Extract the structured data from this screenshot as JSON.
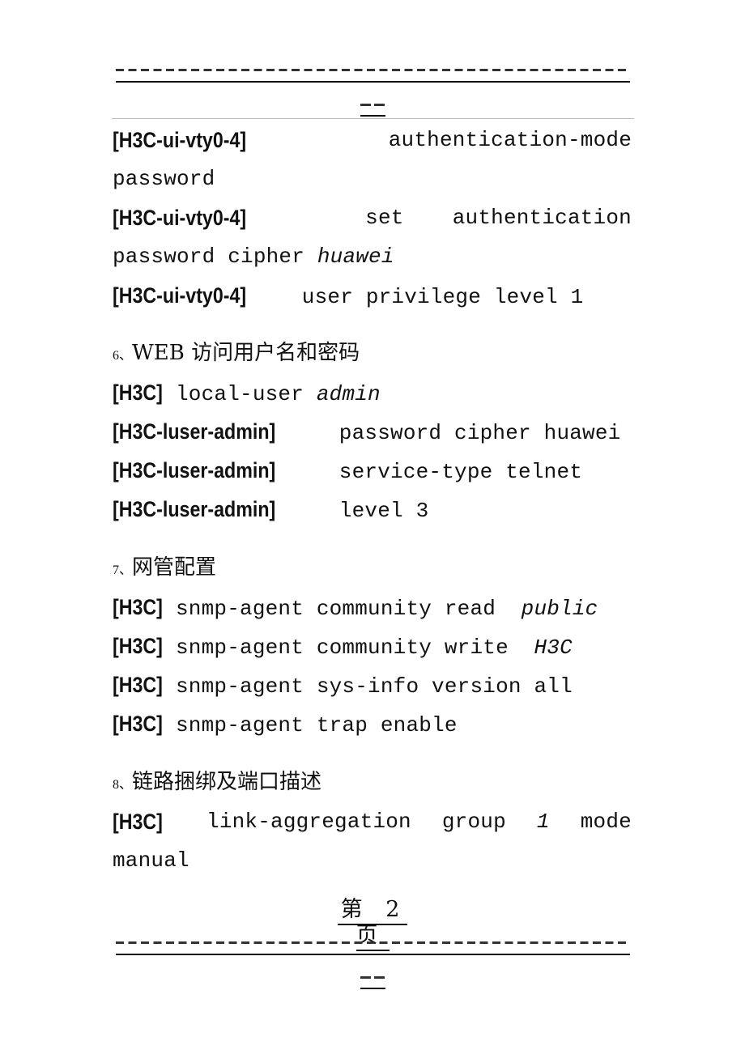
{
  "header": {
    "dash_separator": "----------------------------------------",
    "dash_continuation": "--"
  },
  "sections": [
    {
      "lines": [
        {
          "prompt": "[H3C-ui-vty0-4]",
          "parts": [
            "authentication-mode"
          ],
          "justified": true
        },
        {
          "text": "password"
        },
        {
          "prompt": "[H3C-ui-vty0-4]",
          "parts": [
            "set",
            "authentication"
          ],
          "justified": true
        },
        {
          "text": "password cipher ",
          "italic": "huawei"
        },
        {
          "prompt": "[H3C-ui-vty0-4]",
          "text": " user privilege level 1"
        }
      ]
    },
    {
      "heading_num": "6、",
      "heading": "WEB 访问用户名和密码",
      "lines": [
        {
          "prompt": "[H3C]",
          "text": "local-user ",
          "italic": "admin"
        },
        {
          "prompt": "[H3C-luser-admin]",
          "text": " password cipher huawei"
        },
        {
          "prompt": "[H3C-luser-admin]",
          "text": " service-type telnet"
        },
        {
          "prompt": "[H3C-luser-admin]",
          "text": " level 3"
        }
      ]
    },
    {
      "heading_num": "7、",
      "heading": "网管配置",
      "lines": [
        {
          "prompt": "[H3C]",
          "text": "snmp-agent community read  ",
          "italic": "public"
        },
        {
          "prompt": "[H3C]",
          "text": "snmp-agent community write  ",
          "italic": "H3C"
        },
        {
          "prompt": "[H3C]",
          "text": "snmp-agent sys-info version all"
        },
        {
          "prompt": "[H3C]",
          "text": "snmp-agent trap enable"
        }
      ]
    },
    {
      "heading_num": "8、",
      "heading": "链路捆绑及端口描述",
      "lines": [
        {
          "prompt": "[H3C]",
          "parts": [
            "link-aggregation",
            "group",
            "1",
            "mode"
          ],
          "italic_part_index": 2,
          "justified": true
        },
        {
          "text": "manual"
        }
      ]
    }
  ],
  "footer": {
    "page_label": "第 2 页",
    "page_number": 2
  }
}
